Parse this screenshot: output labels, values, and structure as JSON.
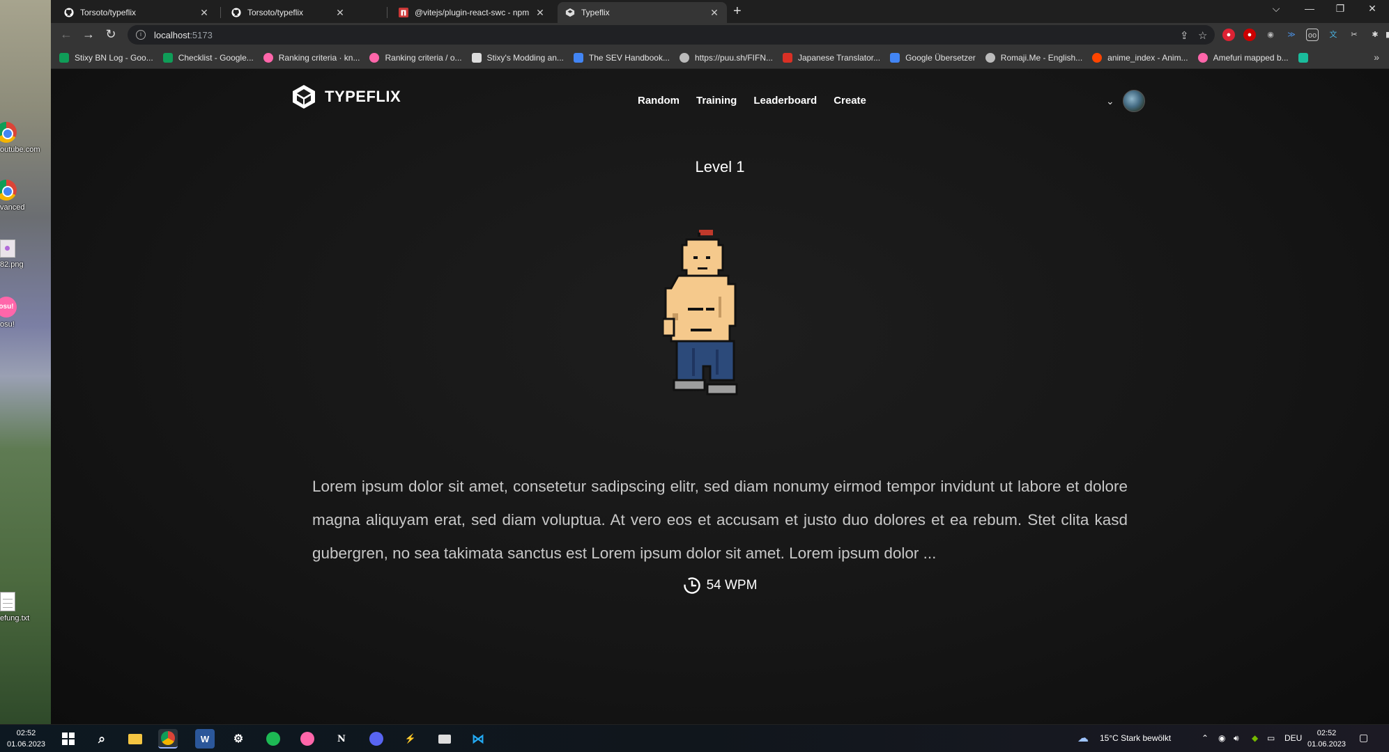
{
  "desktop": {
    "icons": [
      {
        "label": "outube.com",
        "type": "chrome"
      },
      {
        "label": "vanced",
        "type": "chrome"
      },
      {
        "label": "82.png",
        "type": "png"
      },
      {
        "label": "osu!",
        "type": "osu"
      },
      {
        "label": "efung.txt",
        "type": "txt"
      }
    ]
  },
  "browser": {
    "tabs": [
      {
        "title": "Torsoto/typeflix",
        "icon": "github-icon"
      },
      {
        "title": "Torsoto/typeflix",
        "icon": "github-icon"
      },
      {
        "title": "@vitejs/plugin-react-swc - npm",
        "icon": "npm-icon"
      },
      {
        "title": "Typeflix",
        "icon": "typeflix-icon",
        "active": true
      }
    ],
    "address": {
      "host": "localhost",
      "port": ":5173"
    },
    "bookmarks": [
      {
        "label": "Stixy BN Log - Goo...",
        "color": "#0f9d58"
      },
      {
        "label": "Checklist - Google...",
        "color": "#0f9d58"
      },
      {
        "label": "Ranking criteria · kn...",
        "color": "#ff66aa"
      },
      {
        "label": "Ranking criteria / o...",
        "color": "#ff66aa"
      },
      {
        "label": "Stixy's Modding an...",
        "color": "#dddddd"
      },
      {
        "label": "The SEV Handbook...",
        "color": "#4285f4"
      },
      {
        "label": "https://puu.sh/FIFN...",
        "color": "#bbbbbb"
      },
      {
        "label": "Japanese Translator...",
        "color": "#d93025"
      },
      {
        "label": "Google Übersetzer",
        "color": "#4285f4"
      },
      {
        "label": "Romaji.Me - English...",
        "color": "#bbbbbb"
      },
      {
        "label": "anime_index - Anim...",
        "color": "#ff4500"
      },
      {
        "label": "Amefuri mapped b...",
        "color": "#ff66aa"
      }
    ],
    "bookmarks_more": "»"
  },
  "site": {
    "logo_text": "TYPEFLIX",
    "nav": [
      "Random",
      "Training",
      "Leaderboard",
      "Create"
    ],
    "level_title": "Level 1",
    "typing_text": "Lorem ipsum dolor sit amet, consetetur sadipscing elitr, sed diam nonumy eirmod tempor invidunt ut labore et dolore magna aliquyam erat, sed diam voluptua. At vero eos et accusam et justo duo dolores et ea rebum. Stet clita kasd gubergren, no sea takimata sanctus est Lorem ipsum dolor sit amet. Lorem ipsum dolor ...",
    "wpm_label": "54 WPM"
  },
  "taskbar": {
    "time": "02:52",
    "date": "01.06.2023",
    "weather": "15°C  Stark bewölkt",
    "language": "DEU"
  }
}
